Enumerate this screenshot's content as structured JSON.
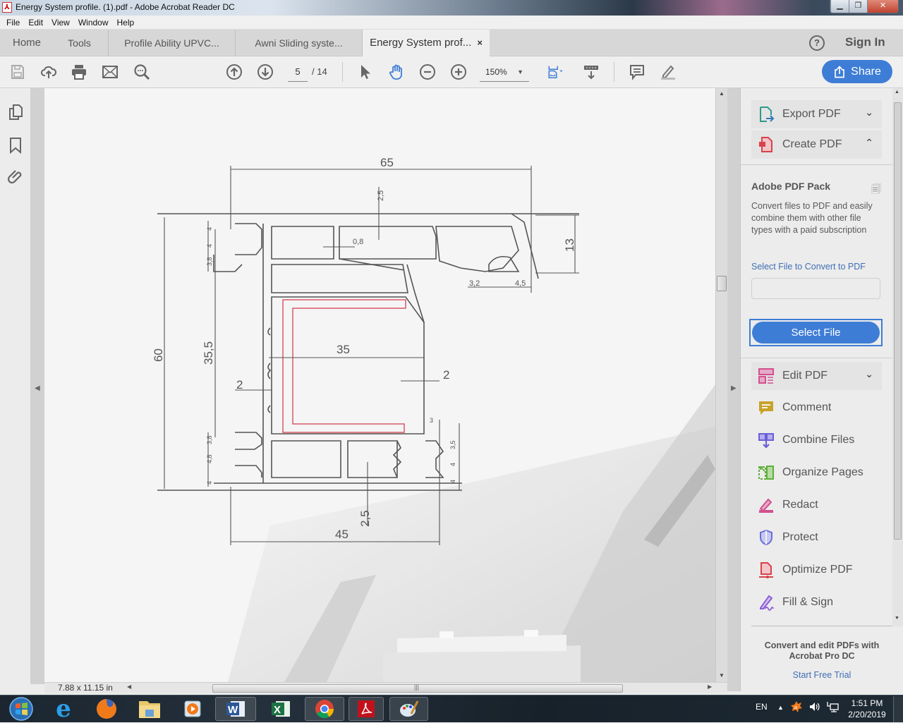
{
  "window": {
    "title": "Energy System profile. (1).pdf - Adobe Acrobat Reader DC",
    "controls": [
      "minimize",
      "restore",
      "close"
    ]
  },
  "menu": [
    "File",
    "Edit",
    "View",
    "Window",
    "Help"
  ],
  "tabs": {
    "home": "Home",
    "tools": "Tools",
    "documents": [
      {
        "label": "Profile Ability UPVC...",
        "active": false
      },
      {
        "label": "Awni Sliding syste...",
        "active": false
      },
      {
        "label": "Energy System prof...",
        "active": true,
        "close": "×"
      }
    ],
    "help": "?",
    "sign_in": "Sign In"
  },
  "toolbar": {
    "icons": [
      "save-icon",
      "upload-cloud-icon",
      "print-icon",
      "email-icon",
      "find-icon",
      "previous-page-icon",
      "next-page-icon",
      "select-arrow-icon",
      "hand-icon",
      "zoom-out-icon",
      "zoom-in-icon",
      "fit-page-icon",
      "scroll-mode-icon",
      "comment-icon",
      "highlight-pen-icon"
    ],
    "current_page": "5",
    "total_pages": "/ 14",
    "zoom": "150%",
    "share": "Share"
  },
  "document": {
    "page_size": "7.88 x 11.15 in",
    "drawing_dimensions": {
      "overall_width_top": "65",
      "overall_width_bottom": "45",
      "overall_height": "60",
      "inner_height": "35,5",
      "inner_width": "35",
      "top_right_height": "13",
      "wall_left": "2",
      "wall_right": "2",
      "web": "0,8",
      "top_offset": "2,5",
      "bottom_offset": "2,5",
      "groove_a": "3,2",
      "groove_b": "4,5",
      "left_top_stack": [
        "4",
        "4",
        "3,8"
      ],
      "left_bottom_stack": [
        "3,8",
        "4,8",
        "4"
      ],
      "right_bottom_stack": [
        "3,5",
        "4",
        "4"
      ],
      "right_small": "3"
    }
  },
  "right_panel": {
    "tools_top": [
      {
        "label": "Export PDF",
        "icon": "export-pdf-icon",
        "chevron": "down",
        "color": "#2e9a8c"
      },
      {
        "label": "Create PDF",
        "icon": "create-pdf-icon",
        "chevron": "up",
        "color": "#d9414b"
      }
    ],
    "pack": {
      "title": "Adobe PDF Pack",
      "description": "Convert files to PDF and easily combine them with other file types with a paid subscription",
      "select_label": "Select File to Convert to PDF",
      "file_input_value": "",
      "select_button": "Select File"
    },
    "tools": [
      {
        "label": "Edit PDF",
        "icon": "edit-pdf-icon",
        "chevron": "down",
        "color": "#d1508f"
      },
      {
        "label": "Comment",
        "icon": "comment-tool-icon",
        "color": "#c9a22b"
      },
      {
        "label": "Combine Files",
        "icon": "combine-files-icon",
        "color": "#6a5fd6"
      },
      {
        "label": "Organize Pages",
        "icon": "organize-pages-icon",
        "color": "#5fae3c"
      },
      {
        "label": "Redact",
        "icon": "redact-icon",
        "color": "#d1508f"
      },
      {
        "label": "Protect",
        "icon": "protect-icon",
        "color": "#6a6ed6"
      },
      {
        "label": "Optimize PDF",
        "icon": "optimize-pdf-icon",
        "color": "#d9414b"
      },
      {
        "label": "Fill & Sign",
        "icon": "fill-sign-icon",
        "color": "#8a5fd6"
      }
    ],
    "promo": {
      "text": "Convert and edit PDFs with Acrobat Pro DC",
      "link": "Start Free Trial"
    }
  },
  "taskbar": {
    "apps": [
      "start",
      "internet-explorer",
      "firefox",
      "file-explorer",
      "media-player",
      "word",
      "excel",
      "chrome",
      "acrobat",
      "paint"
    ],
    "language": "EN",
    "time": "1:51 PM",
    "date": "2/20/2019"
  },
  "colors": {
    "accent": "#3e7dd6",
    "link": "#3f6fb5"
  }
}
